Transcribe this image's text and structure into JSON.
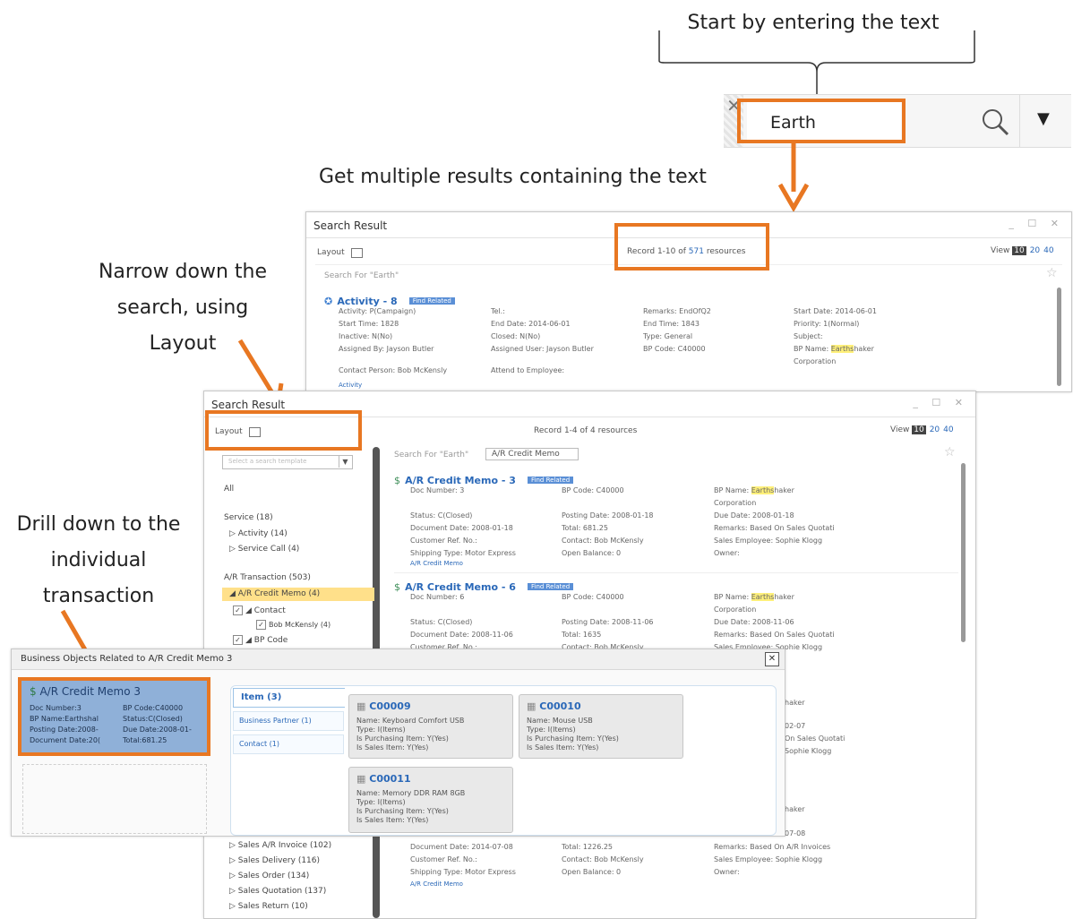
{
  "callouts": {
    "start": "Start by entering the text",
    "multiple": "Get multiple results containing the text",
    "narrow": [
      "Narrow down the",
      "search, using",
      "Layout"
    ],
    "drill": [
      "Drill down to the",
      "individual",
      "transaction"
    ]
  },
  "colors": {
    "accent": "#e87722",
    "link": "#2a68b8",
    "badge": "#5a8fd6",
    "highlight": "#fff07a",
    "selected": "#ffe08a"
  },
  "searchbar": {
    "value": "Earth",
    "clear_icon": "close-icon",
    "search_icon": "search-icon",
    "dropdown_icon": "dropdown-icon"
  },
  "win1": {
    "title": "Search Result",
    "layout_label": "Layout",
    "record_prefix": "Record 1-10 of ",
    "record_count": "571",
    "record_suffix": " resources",
    "view_label": "View",
    "pages": [
      "10",
      "20",
      "40"
    ],
    "search_for": "Search For \"Earth\"",
    "result": {
      "title": "Activity - 8",
      "badge": "Find Related",
      "col1": [
        "Activity: P(Campaign)",
        "Start Time: 1828",
        "Inactive: N(No)",
        "Assigned By: Jayson Butler"
      ],
      "col2": [
        "Tel.:",
        "End Date: 2014-06-01",
        "Closed: N(No)",
        "Assigned User: Jayson Butler"
      ],
      "col3": [
        "Remarks: EndOfQ2",
        "End Time: 1843",
        "Type: General",
        "BP Code: C40000"
      ],
      "col4": [
        "Start Date: 2014-06-01",
        "Priority: 1(Normal)",
        "Subject:"
      ],
      "bp_prefix": "BP Name: ",
      "bp_hl": "Earths",
      "bp_rest": "haker",
      "bp_line2": "Corporation",
      "contact": "Contact Person: Bob McKensly",
      "attend": "Attend to Employee:",
      "footer": "Activity"
    }
  },
  "win2": {
    "title": "Search Result",
    "layout_label": "Layout",
    "record": "Record 1-4 of 4 resources",
    "view_label": "View",
    "pages": [
      "10",
      "20",
      "40"
    ],
    "search_for": "Search For \"Earth\"",
    "filter_tag": "A/R Credit Memo",
    "template_placeholder": "Select a search template",
    "sidebar": [
      {
        "text": "All"
      },
      {
        "text": "Service (18)"
      },
      {
        "text": "▷ Activity (14)"
      },
      {
        "text": "▷ Service Call (4)"
      },
      {
        "text": "A/R Transaction (503)"
      },
      {
        "text": "◢ A/R Credit Memo (4)"
      },
      {
        "text": "◢ Contact"
      },
      {
        "text": "Bob McKensly (4)"
      },
      {
        "text": "◢ BP Code"
      },
      {
        "text": "▷ Sales A/R Invoice (102)"
      },
      {
        "text": "▷ Sales Delivery (116)"
      },
      {
        "text": "▷ Sales Order (134)"
      },
      {
        "text": "▷ Sales Quotation (137)"
      },
      {
        "text": "▷ Sales Return (10)"
      }
    ],
    "results": [
      {
        "title": "A/R Credit Memo - 3",
        "badge": "Find Related",
        "c1": [
          "Doc Number: 3",
          "",
          "Status: C(Closed)",
          "Document Date: 2008-01-18",
          "Customer Ref. No.:",
          "Shipping Type: Motor Express"
        ],
        "c2": [
          "BP Code: C40000",
          "",
          "Posting Date: 2008-01-18",
          "Total: 681.25",
          "Contact: Bob McKensly",
          "Open Balance: 0"
        ],
        "c3": [
          "Corporation",
          "Due Date: 2008-01-18",
          "Remarks: Based On Sales Quotati",
          "Sales Employee: Sophie Klogg",
          "Owner:"
        ],
        "footer": "A/R Credit Memo"
      },
      {
        "title": "A/R Credit Memo - 6",
        "badge": "Find Related",
        "c1": [
          "Doc Number: 6",
          "",
          "Status: C(Closed)",
          "Document Date: 2008-11-06",
          "Customer Ref. No.:"
        ],
        "c2": [
          "BP Code: C40000",
          "",
          "Posting Date: 2008-11-06",
          "Total: 1635",
          "Contact: Bob McKensly"
        ],
        "c3": [
          "Corporation",
          "Due Date: 2008-11-06",
          "Remarks: Based On Sales Quotati",
          "Sales Employee: Sophie Klogg"
        ]
      }
    ],
    "bp_prefix": "BP Name: ",
    "bp_hl": "Earths",
    "bp_rest": "haker",
    "right_fragments": [
      "haker",
      "02-07",
      "On Sales Quotati",
      "Sophie Klogg",
      "haker",
      "07-08"
    ],
    "bottom": {
      "c1": [
        "Document Date: 2014-07-08",
        "Customer Ref. No.:",
        "Shipping Type: Motor Express"
      ],
      "c2": [
        "Total: 1226.25",
        "Contact: Bob McKensly",
        "Open Balance: 0"
      ],
      "c3": [
        "Remarks: Based On A/R Invoices",
        "Sales Employee: Sophie Klogg",
        "Owner:"
      ],
      "footer": "A/R Credit Memo"
    }
  },
  "win3": {
    "title": "Business Objects Related to A/R Credit Memo 3",
    "doc": {
      "title": "A/R Credit Memo 3",
      "l1a": "Doc Number:3",
      "l1b": "BP Code:C40000",
      "l2a": "BP Name:Earthshal",
      "l2b": "Status:C(Closed)",
      "l3a": "Posting Date:2008-",
      "l3b": "Due Date:2008-01-",
      "l4a": "Document Date:20(",
      "l4b": "Total:681.25"
    },
    "tabs": [
      "Item (3)",
      "Business Partner (1)",
      "Contact (1)"
    ],
    "items": [
      {
        "code": "C00009",
        "lines": [
          "Name: Keyboard Comfort USB",
          "Type: I(Items)",
          "Is Purchasing Item: Y(Yes)",
          "Is Sales Item: Y(Yes)"
        ]
      },
      {
        "code": "C00010",
        "lines": [
          "Name: Mouse USB",
          "Type: I(Items)",
          "Is Purchasing Item: Y(Yes)",
          "Is Sales Item: Y(Yes)"
        ]
      },
      {
        "code": "C00011",
        "lines": [
          "Name: Memory DDR RAM 8GB",
          "Type: I(Items)",
          "Is Purchasing Item: Y(Yes)",
          "Is Sales Item: Y(Yes)"
        ]
      }
    ]
  }
}
